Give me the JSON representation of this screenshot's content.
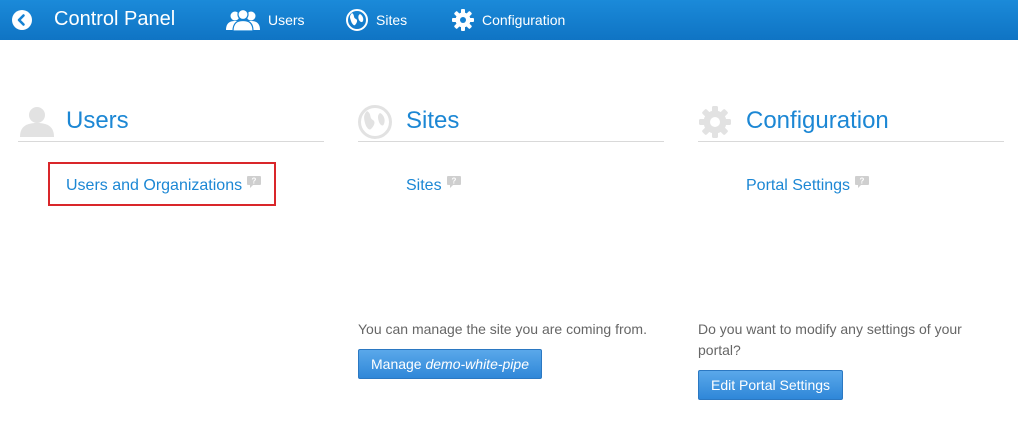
{
  "topbar": {
    "title": "Control Panel",
    "nav": [
      {
        "label": "Users",
        "icon": "users-icon"
      },
      {
        "label": "Sites",
        "icon": "globe-icon"
      },
      {
        "label": "Configuration",
        "icon": "gear-icon"
      }
    ]
  },
  "columns": {
    "users": {
      "title": "Users",
      "icon": "users-icon",
      "links": [
        "Users and Organizations"
      ]
    },
    "sites": {
      "title": "Sites",
      "icon": "globe-icon",
      "links": [
        "Sites"
      ],
      "description": "You can manage the site you are coming from.",
      "button_prefix": "Manage ",
      "button_site": "demo-white-pipe"
    },
    "configuration": {
      "title": "Configuration",
      "icon": "gear-icon",
      "links": [
        "Portal Settings"
      ],
      "description": "Do you want to modify any settings of your portal?",
      "button": "Edit Portal Settings"
    }
  },
  "colors": {
    "topbar": "#1582d3",
    "link": "#1c87d4",
    "highlight": "#d9262a",
    "button": "#3c92de"
  }
}
